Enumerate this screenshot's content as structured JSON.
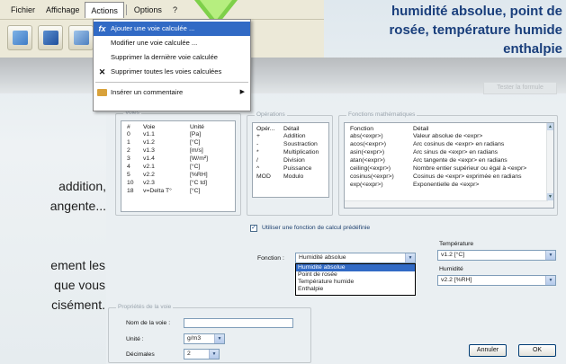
{
  "menubar": {
    "items": [
      "Fichier",
      "Affichage",
      "Actions",
      "Options",
      "?"
    ]
  },
  "dropdown": {
    "items": [
      {
        "label": "Ajouter une voie calculée ...",
        "icon": "fx-icon",
        "highlighted": true
      },
      {
        "label": "Modifier une voie calculée ...",
        "icon": "",
        "highlighted": false
      },
      {
        "label": "Supprimer la dernière voie calculée",
        "icon": "",
        "highlighted": false
      },
      {
        "label": "Supprimer toutes les voies calculées",
        "icon": "close-icon",
        "highlighted": false
      },
      {
        "label": "Insérer un commentaire",
        "icon": "comment-icon",
        "highlighted": false,
        "submenu": true
      }
    ]
  },
  "captions": {
    "top": [
      "humidité absolue, point de",
      "rosée, température humide",
      "enthalpie"
    ],
    "left_a": [
      "addition,",
      "angente..."
    ],
    "left_b": [
      "ement les",
      "que vous",
      "cisément."
    ]
  },
  "ghost_button": "Tester la formule",
  "voies": {
    "title": "Voies",
    "headers": [
      "#",
      "Voie",
      "Unité"
    ],
    "rows": [
      [
        "0",
        "v1.1",
        "[Pa]"
      ],
      [
        "1",
        "v1.2",
        "[°C]"
      ],
      [
        "2",
        "v1.3",
        "[m/s]"
      ],
      [
        "3",
        "v1.4",
        "[W/m²]"
      ],
      [
        "4",
        "v2.1",
        "[°C]"
      ],
      [
        "5",
        "v2.2",
        "[%RH]"
      ],
      [
        "10",
        "v2.3",
        "[°C td]"
      ],
      [
        "18",
        "v=Delta T°",
        "[°C]"
      ]
    ]
  },
  "operations": {
    "title": "Opérations",
    "headers": [
      "Opér...",
      "Détail"
    ],
    "rows": [
      [
        "+",
        "Addition"
      ],
      [
        "-",
        "Soustraction"
      ],
      [
        "*",
        "Multiplication"
      ],
      [
        "/",
        "Division"
      ],
      [
        "^",
        "Puissance"
      ],
      [
        "MOD",
        "Modulo"
      ]
    ]
  },
  "fonctions": {
    "title": "Fonctions mathématiques",
    "headers": [
      "Fonction",
      "Détail"
    ],
    "rows": [
      [
        "abs(<expr>)",
        "Valeur absolue de <expr>"
      ],
      [
        "acos(<expr>)",
        "Arc cosinus de <expr> en radians"
      ],
      [
        "asin(<expr>)",
        "Arc sinus de <expr> en radians"
      ],
      [
        "atan(<expr>)",
        "Arc tangente de <expr> en radians"
      ],
      [
        "ceiling(<expr>)",
        "Nombre entier supérieur ou égal à <expr>"
      ],
      [
        "cosinus(<expr>)",
        "Cosinus de <expr> exprimée en radians"
      ],
      [
        "exp(<expr>)",
        "Exponentielle de <expr>"
      ]
    ]
  },
  "predefined": {
    "checkbox_label": "Utiliser une fonction de calcul prédéfinie",
    "checked": true,
    "fonction_label": "Fonction :",
    "fonction_value": "Humidité absolue",
    "options": [
      "Humidité absolue",
      "Point de rosée",
      "Température humide",
      "Enthalpie"
    ],
    "selected_index": 0,
    "temperature_label": "Température",
    "temperature_value": "v1.2 [°C]",
    "humidite_label": "Humidité",
    "humidite_value": "v2.2 [%RH]"
  },
  "proprietes": {
    "title": "Propriétés de la voie",
    "nom_label": "Nom de la voie :",
    "nom_value": "",
    "unite_label": "Unité :",
    "unite_value": "g/m3",
    "decimales_label": "Décimales",
    "decimales_value": "2"
  },
  "buttons": {
    "cancel": "Annuler",
    "ok": "OK"
  }
}
